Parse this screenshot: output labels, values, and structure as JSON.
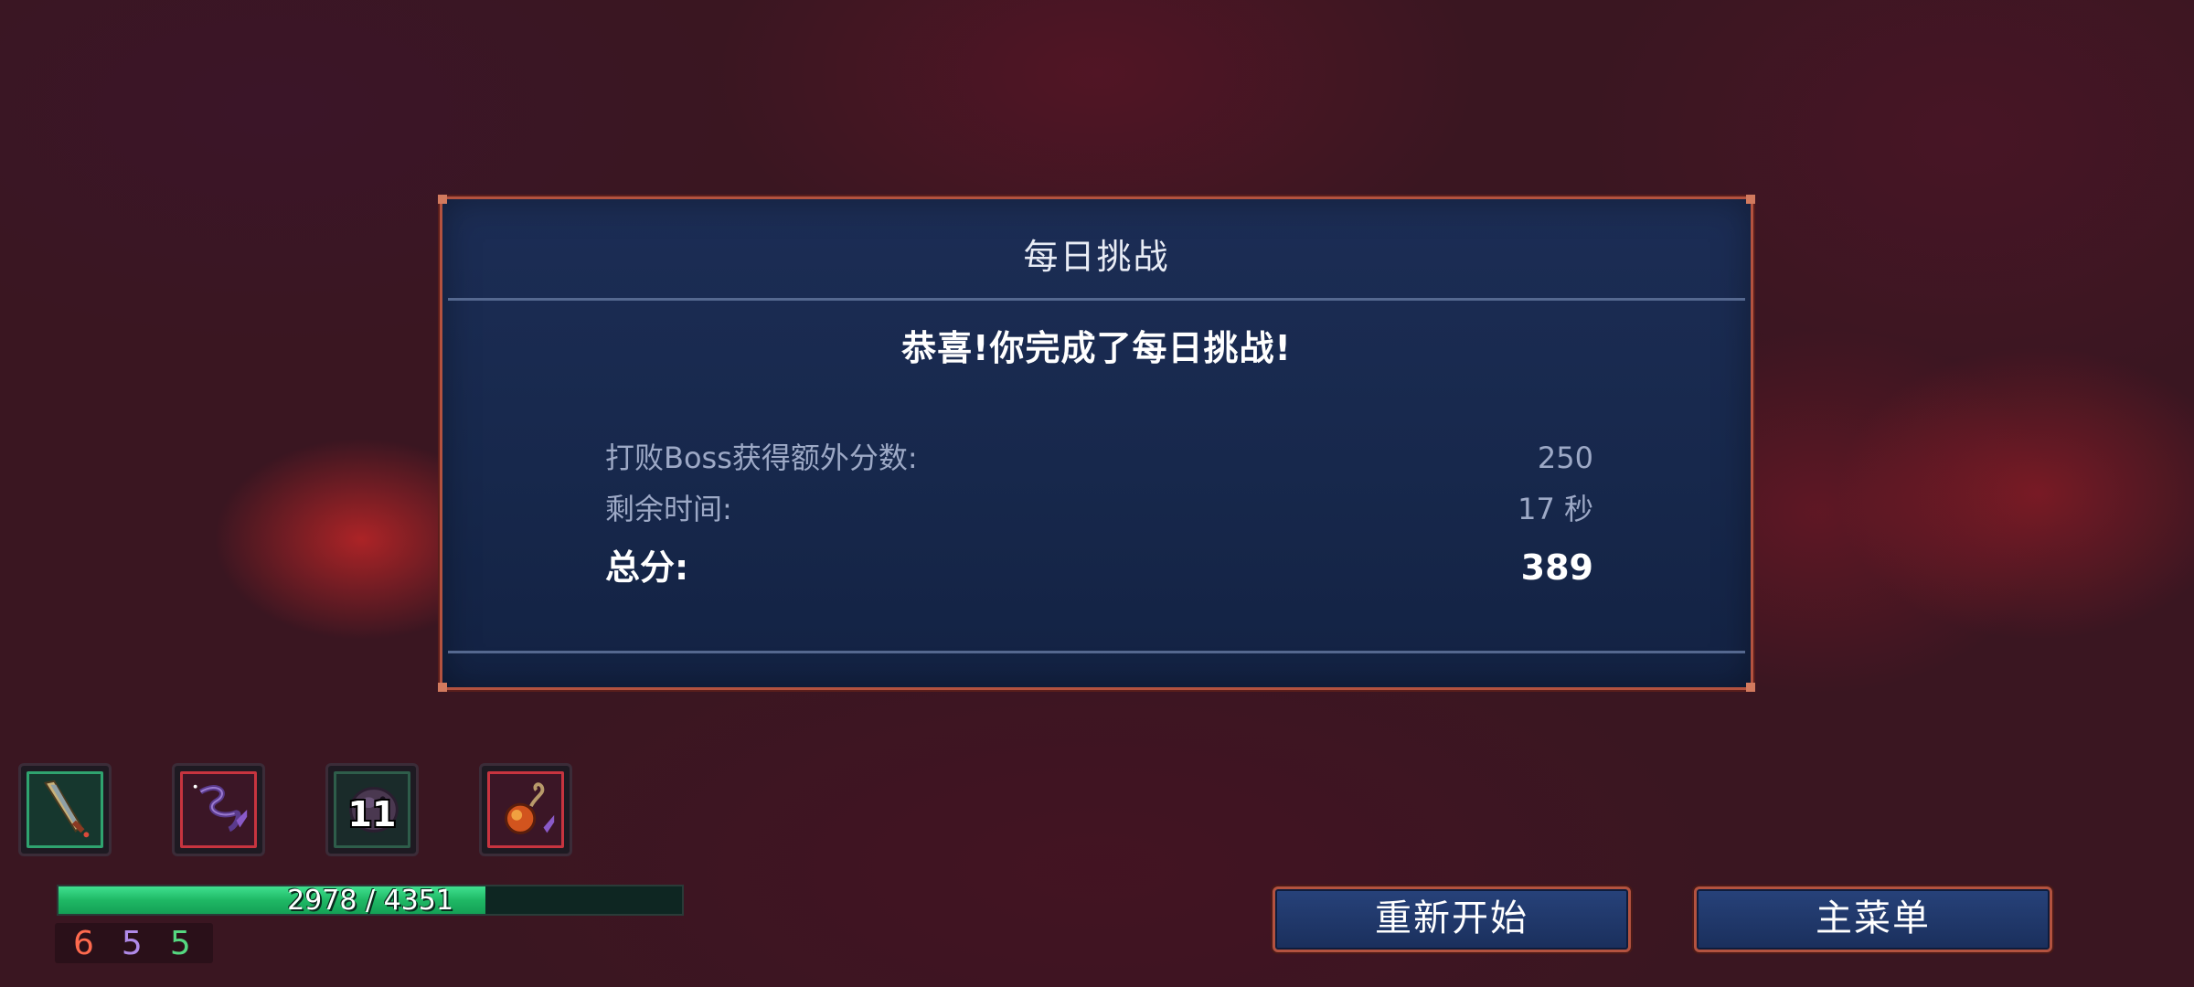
{
  "dialog": {
    "title": "每日挑战",
    "congrats": "恭喜!你完成了每日挑战!",
    "stats": [
      {
        "label": "打败Boss获得额外分数:",
        "value": "250"
      },
      {
        "label": "剩余时间:",
        "value": "17 秒"
      },
      {
        "label": "总分:",
        "value": "389"
      }
    ]
  },
  "items": [
    {
      "icon": "sword-icon",
      "frame": "green"
    },
    {
      "icon": "whip-icon",
      "frame": "red"
    },
    {
      "icon": "grenade-icon",
      "frame": "dark",
      "count": "11"
    },
    {
      "icon": "fire-orb-icon",
      "frame": "red"
    }
  ],
  "health": {
    "text": "2978 / 4351",
    "current": 2978,
    "max": 4351
  },
  "scrolls": {
    "brutality": "6",
    "tactics": "5",
    "survival": "5"
  },
  "buttons": {
    "restart": "重新开始",
    "main_menu": "主菜单"
  },
  "colors": {
    "frame": "#b3523f",
    "panel": "#1a2b52",
    "hp": "#1fb865",
    "brutality": "#ff6a4e",
    "tactics": "#b08ae8",
    "survival": "#55d880"
  }
}
